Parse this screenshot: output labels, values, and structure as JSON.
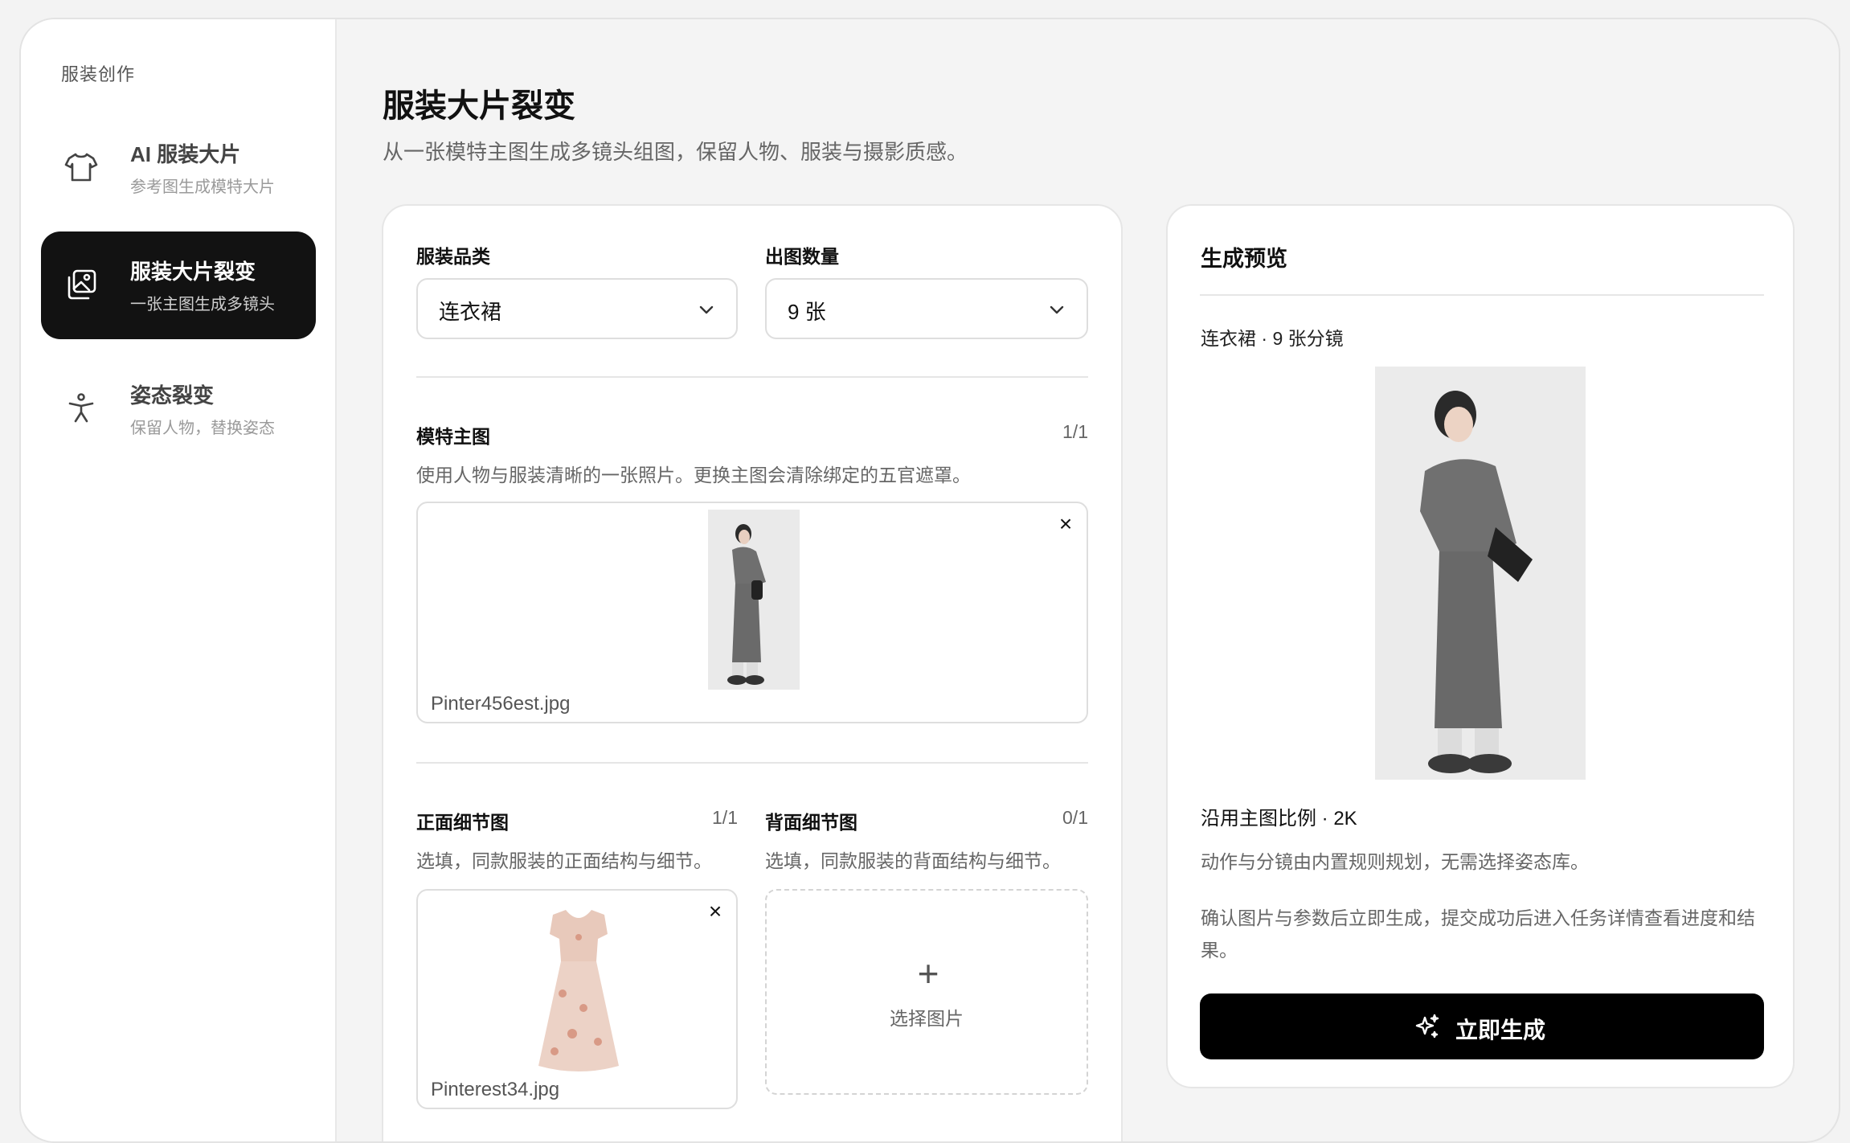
{
  "sidebar": {
    "section_title": "服装创作",
    "items": [
      {
        "title": "AI 服装大片",
        "subtitle": "参考图生成模特大片",
        "icon": "tshirt-icon"
      },
      {
        "title": "服装大片裂变",
        "subtitle": "一张主图生成多镜头",
        "icon": "gallery-icon"
      },
      {
        "title": "姿态裂变",
        "subtitle": "保留人物，替换姿态",
        "icon": "person-icon"
      }
    ]
  },
  "page": {
    "title": "服装大片裂变",
    "subtitle": "从一张模特主图生成多镜头组图，保留人物、服装与摄影质感。"
  },
  "form": {
    "category": {
      "label": "服装品类",
      "value": "连衣裙"
    },
    "quantity": {
      "label": "出图数量",
      "value": "9 张"
    },
    "main_image": {
      "label": "模特主图",
      "count": "1/1",
      "hint": "使用人物与服装清晰的一张照片。更换主图会清除绑定的五官遮罩。",
      "file_name": "Pinter456est.jpg"
    },
    "front_detail": {
      "label": "正面细节图",
      "count": "1/1",
      "hint": "选填，同款服装的正面结构与细节。",
      "file_name": "Pinterest34.jpg"
    },
    "back_detail": {
      "label": "背面细节图",
      "count": "0/1",
      "hint": "选填，同款服装的背面结构与细节。",
      "pick_label": "选择图片"
    }
  },
  "preview": {
    "title": "生成预览",
    "summary": "连衣裙 · 9 张分镜",
    "ratio": "沿用主图比例 · 2K",
    "note1": "动作与分镜由内置规则规划，无需选择姿态库。",
    "note2": "确认图片与参数后立即生成，提交成功后进入任务详情查看进度和结果。",
    "generate_label": "立即生成"
  },
  "colors": {
    "accent": "#121212",
    "background": "#f4f4f4",
    "card": "#ffffff"
  }
}
